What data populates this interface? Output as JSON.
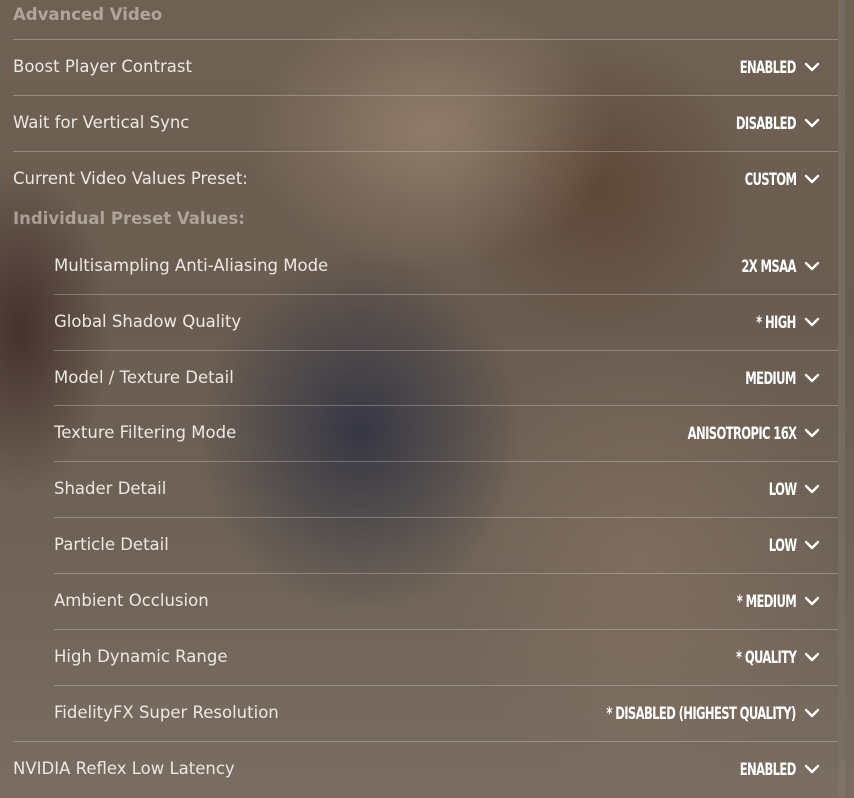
{
  "section_title": "Advanced Video",
  "top_settings": [
    {
      "label": "Boost Player Contrast",
      "value": "ENABLED"
    },
    {
      "label": "Wait for Vertical Sync",
      "value": "DISABLED"
    },
    {
      "label": "Current Video Values Preset:",
      "value": "CUSTOM"
    }
  ],
  "subsection_title": "Individual Preset Values:",
  "preset_settings": [
    {
      "label": "Multisampling Anti-Aliasing Mode",
      "value": "2X MSAA"
    },
    {
      "label": "Global Shadow Quality",
      "value": "* HIGH"
    },
    {
      "label": "Model / Texture Detail",
      "value": "MEDIUM"
    },
    {
      "label": "Texture Filtering Mode",
      "value": "ANISOTROPIC 16X"
    },
    {
      "label": "Shader Detail",
      "value": "LOW"
    },
    {
      "label": "Particle Detail",
      "value": "LOW"
    },
    {
      "label": "Ambient Occlusion",
      "value": "* MEDIUM"
    },
    {
      "label": "High Dynamic Range",
      "value": "* QUALITY"
    },
    {
      "label": "FidelityFX Super Resolution",
      "value": "* DISABLED (HIGHEST QUALITY)"
    }
  ],
  "bottom_settings": [
    {
      "label": "NVIDIA Reflex Low Latency",
      "value": "ENABLED"
    }
  ],
  "icons": {
    "dropdown": "chevron-down-icon"
  }
}
